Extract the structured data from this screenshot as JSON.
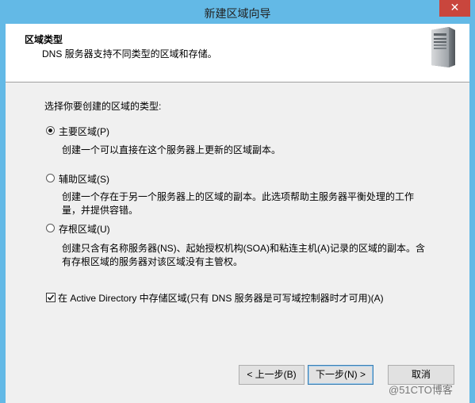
{
  "window": {
    "title": "新建区域向导",
    "close_glyph": "✕"
  },
  "header": {
    "title": "区域类型",
    "subtitle": "DNS 服务器支持不同类型的区域和存储。",
    "icon": "server-icon"
  },
  "main": {
    "prompt": "选择你要创建的区域的类型:",
    "options": [
      {
        "label": "主要区域(P)",
        "selected": true,
        "description_lines": [
          "创建一个可以直接在这个服务器上更新的区域副本。"
        ]
      },
      {
        "label": "辅助区域(S)",
        "selected": false,
        "description_lines": [
          "创建一个存在于另一个服务器上的区域的副本。此选项帮助主服务器平衡处理的工作",
          "量，并提供容错。"
        ]
      },
      {
        "label": "存根区域(U)",
        "selected": false,
        "description_lines": [
          "创建只含有名称服务器(NS)、起始授权机构(SOA)和粘连主机(A)记录的区域的副本。含",
          "有存根区域的服务器对该区域没有主管权。"
        ]
      }
    ],
    "ad_store": {
      "checked": true,
      "label": "在 Active Directory 中存储区域(只有 DNS 服务器是可写域控制器时才可用)(A)"
    }
  },
  "buttons": {
    "back": "< 上一步(B)",
    "next": "下一步(N) >",
    "cancel": "取消"
  },
  "watermark": "@51CTO博客"
}
